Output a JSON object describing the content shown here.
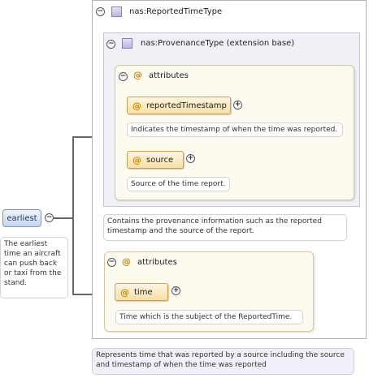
{
  "element": {
    "name": "earliest",
    "doc": "The earliest time an aircraft can push back or taxi from the stand."
  },
  "type_box": {
    "name": "nas:ReportedTimeType",
    "doc": "Represents time that was reported by a source including the source and timestamp of when the time was reported"
  },
  "extension": {
    "name": "nas:ProvenanceType (extension base)",
    "doc": "Contains the provenance information such as the reported timestamp and the source of the report."
  },
  "attrs_group_1": {
    "label": "attributes",
    "items": [
      {
        "name": "reportedTimestamp",
        "doc": "Indicates the timestamp of when the time was reported."
      },
      {
        "name": "source",
        "doc": "Source of the time report."
      }
    ]
  },
  "attrs_group_2": {
    "label": "attributes",
    "items": [
      {
        "name": "time",
        "doc": "Time which is the subject of the ReportedTime."
      }
    ]
  },
  "icons": {
    "collapse": "minus-circle-icon",
    "expand": "plus-circle-icon",
    "complex_type": "complex-type-square-icon",
    "attribute": "at-sign-icon"
  },
  "glyphs": {
    "collapse": "−",
    "expand": "+",
    "at": "@"
  }
}
